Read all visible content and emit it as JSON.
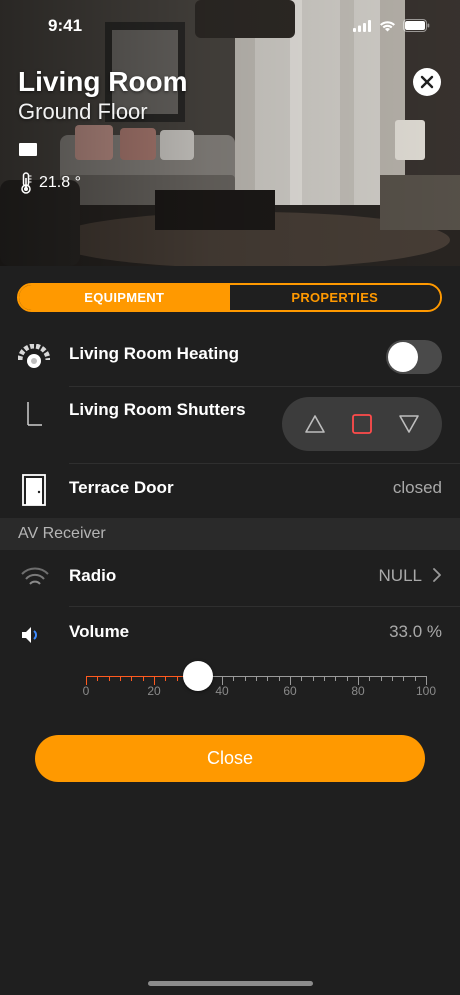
{
  "status_bar": {
    "time": "9:41"
  },
  "room": {
    "title": "Living Room",
    "subtitle": "Ground Floor",
    "temperature": "21.8 °"
  },
  "tabs": [
    {
      "label": "EQUIPMENT",
      "active": true
    },
    {
      "label": "PROPERTIES",
      "active": false
    }
  ],
  "equipment": {
    "heating": {
      "label": "Living Room Heating",
      "on": false,
      "icon": "heating-icon"
    },
    "shutters": {
      "label": "Living Room Shutters",
      "icon": "shutter-icon"
    },
    "door": {
      "label": "Terrace Door",
      "value": "closed",
      "icon": "door-icon"
    }
  },
  "av_section": {
    "title": "AV Receiver"
  },
  "radio": {
    "label": "Radio",
    "value": "NULL",
    "icon": "wifi-icon"
  },
  "volume": {
    "label": "Volume",
    "value": "33.0 %",
    "level": 33,
    "min": 0,
    "max": 100,
    "tick_labels": [
      "0",
      "20",
      "40",
      "60",
      "80",
      "100"
    ],
    "icon": "speaker-icon"
  },
  "close_button": {
    "label": "Close"
  },
  "colors": {
    "accent": "#ff9900",
    "background": "#1f1f1f",
    "slider_active": "#ff5a1f"
  }
}
